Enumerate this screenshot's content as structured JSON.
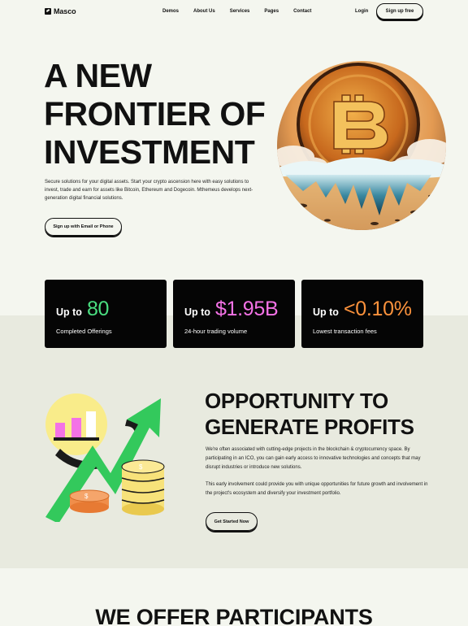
{
  "nav": {
    "brand": "Masco",
    "links": [
      "Demos",
      "About Us",
      "Services",
      "Pages",
      "Contact"
    ],
    "login": "Login",
    "signup": "Sign up free"
  },
  "hero": {
    "title_lines": [
      "A NEW",
      "FRONTIER OF",
      "INVESTMENT"
    ],
    "description": "Secure solutions for your digital assets. Start your crypto ascension here with easy solutions to invest, trade and earn for assets like Bitcoin, Ethereum and Dogecoin. Mthemeus develops next-generation digital financial solutions.",
    "cta": "Sign up with Email or Phone",
    "image_icon": "bitcoin-illustration"
  },
  "stats": [
    {
      "prefix": "Up to",
      "value": "80",
      "label": "Completed Offerings",
      "color": "#4ade80"
    },
    {
      "prefix": "Up to",
      "value": "$1.95B",
      "label": "24-hour trading volume",
      "color": "#f472e6"
    },
    {
      "prefix": "Up to",
      "value": "<0.10%",
      "label": "Lowest transaction fees",
      "color": "#fb923c"
    }
  ],
  "opportunity": {
    "title_lines": [
      "OPPORTUNITY TO",
      "GENERATE PROFITS"
    ],
    "p1": "We're often associated with cutting-edge projects in the blockchain & cryptocurrency space. By participating in an ICO, you can gain early access to innovative technologies and concepts that may disrupt industries or introduce new solutions.",
    "p2": "This early involvement could provide you with unique opportunities for future growth and involvement in the project's ecosystem and diversify your investment portfolio.",
    "cta": "Get Started Now",
    "image_icon": "growth-chart-coins-illustration"
  },
  "next_section": {
    "title": "WE OFFER PARTICIPANTS"
  }
}
